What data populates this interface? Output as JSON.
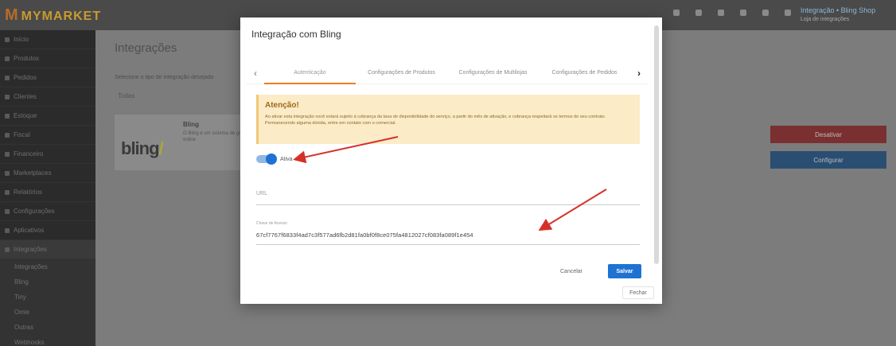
{
  "app": {
    "logo_text": "MYMARKET",
    "user_name": "Integração • Bling Shop",
    "user_store": "Loja de integrações",
    "top_icons": [
      "refresh-icon",
      "bell-icon",
      "flag-icon",
      "help-icon",
      "cart-icon",
      "grid-icon"
    ]
  },
  "sidebar": {
    "items": [
      {
        "label": "Início"
      },
      {
        "label": "Produtos"
      },
      {
        "label": "Pedidos"
      },
      {
        "label": "Clientes"
      },
      {
        "label": "Estoque"
      },
      {
        "label": "Fiscal"
      },
      {
        "label": "Financeiro"
      },
      {
        "label": "Marketplaces"
      },
      {
        "label": "Relatórios"
      },
      {
        "label": "Configurações"
      },
      {
        "label": "Aplicativos"
      },
      {
        "label": "Integrações"
      }
    ],
    "sub_items": [
      {
        "label": "Integrações"
      },
      {
        "label": "Bling"
      },
      {
        "label": "Tiny"
      },
      {
        "label": "Omie"
      },
      {
        "label": "Outras"
      },
      {
        "label": "Webhooks"
      }
    ]
  },
  "main": {
    "page_title": "Integrações",
    "breadcrumb": "Selecione o tipo de integração desejado",
    "filter_text": "Todas",
    "card": {
      "logo": "bling",
      "name": "Bling",
      "description": "O Bling é um sistema de gestão online"
    },
    "btn_red": "Desativar",
    "btn_blue": "Configurar"
  },
  "modal": {
    "title": "Integração com Bling",
    "tabs": [
      {
        "label": "Autenticação",
        "active": true
      },
      {
        "label": "Configurações de Produtos",
        "active": false
      },
      {
        "label": "Configurações de Multilojas",
        "active": false
      },
      {
        "label": "Configurações de Pedidos",
        "active": false
      }
    ],
    "alert": {
      "title": "Atenção!",
      "text": "Ao ativar esta integração você estará sujeito à cobrança da taxa de disponibilidade do serviço, a partir do mês de ativação, e cobrança respeitará os termos do seu contrato. Permanecendo alguma dúvida, entre em contato com o comercial."
    },
    "toggle": {
      "label": "Ativa",
      "on": true
    },
    "url_field": {
      "placeholder": "URL",
      "value": ""
    },
    "key_field": {
      "label": "Chave de Acesso",
      "value": "67cf7767f6833f4ad7c3f577ad6fb2d81fa0bf0f8ce075fa4812027cf083fa089f1e454"
    },
    "buttons": {
      "cancel": "Cancelar",
      "save": "Salvar",
      "close": "Fechar"
    }
  },
  "colors": {
    "accent": "#1e73d2",
    "tab_active": "#f07b1e",
    "alert_bg": "#fbebc7",
    "arrow": "#d6302b"
  }
}
